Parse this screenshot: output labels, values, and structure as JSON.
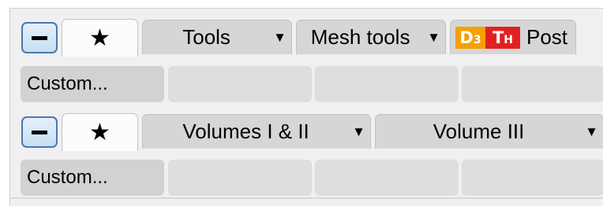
{
  "toolbar1": {
    "collapse_icon": "minus-icon",
    "favorites_icon": "★",
    "tabs": [
      {
        "label": "Tools",
        "dropdown": "▼"
      },
      {
        "label": "Mesh tools",
        "dropdown": "▼"
      }
    ],
    "post": {
      "logo_d": "D",
      "logo_d_sub": "3",
      "logo_t": "T",
      "logo_t_sub": "H",
      "label": "Post",
      "logo_colors": {
        "d3": "#f5a000",
        "th": "#e32020"
      }
    },
    "buttons": {
      "custom_label": "Custom..."
    }
  },
  "toolbar2": {
    "collapse_icon": "minus-icon",
    "favorites_icon": "★",
    "tabs": [
      {
        "label": "Volumes I & II",
        "dropdown": "▼"
      },
      {
        "label": "Volume III",
        "dropdown": "▼"
      }
    ],
    "buttons": {
      "custom_label": "Custom..."
    }
  },
  "colors": {
    "panel_bg": "#f0f0f0",
    "tab_bg": "#d6d6d6",
    "active_tab_bg": "#fcfcfc",
    "collapse_border": "#4a78b0",
    "collapse_fill": "#c7dff4"
  }
}
